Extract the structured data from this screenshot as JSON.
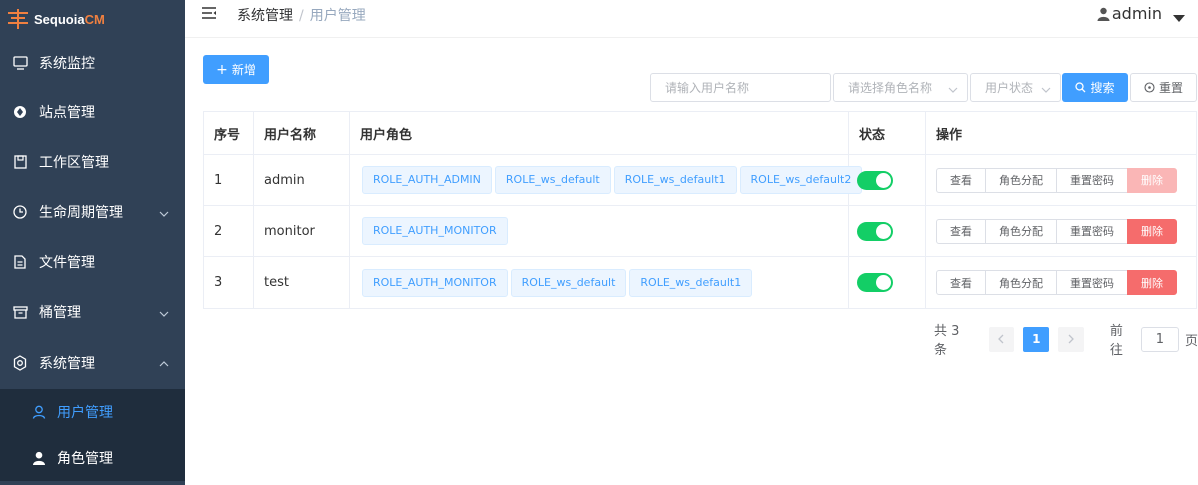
{
  "app": {
    "logo_main": "Sequoia",
    "logo_accent": "CM",
    "accent_color": "#409eff",
    "sidebar_bg": "#304156"
  },
  "sidebar": {
    "items": [
      {
        "label": "系统监控",
        "icon": "monitor-icon"
      },
      {
        "label": "站点管理",
        "icon": "site-icon"
      },
      {
        "label": "工作区管理",
        "icon": "workspace-icon"
      },
      {
        "label": "生命周期管理",
        "icon": "clock-icon",
        "expandable": true
      },
      {
        "label": "文件管理",
        "icon": "file-icon"
      },
      {
        "label": "桶管理",
        "icon": "bucket-icon",
        "expandable": true
      },
      {
        "label": "系统管理",
        "icon": "gear-icon",
        "expanded": true
      }
    ],
    "subitems": [
      {
        "label": "用户管理",
        "icon": "user-icon",
        "active": true
      },
      {
        "label": "角色管理",
        "icon": "user-filled-icon"
      }
    ]
  },
  "header": {
    "breadcrumb": [
      "系统管理",
      "用户管理"
    ],
    "username": "admin"
  },
  "toolbar": {
    "add_label": "新增",
    "username_placeholder": "请输入用户名称",
    "role_placeholder": "请选择角色名称",
    "status_placeholder": "用户状态",
    "search_label": "搜索",
    "reset_label": "重置"
  },
  "table": {
    "headers": [
      "序号",
      "用户名称",
      "用户角色",
      "状态",
      "操作"
    ],
    "rows": [
      {
        "index": "1",
        "name": "admin",
        "roles": [
          "ROLE_AUTH_ADMIN",
          "ROLE_ws_default",
          "ROLE_ws_default1",
          "ROLE_ws_default2"
        ],
        "enabled": true,
        "delete_disabled": true
      },
      {
        "index": "2",
        "name": "monitor",
        "roles": [
          "ROLE_AUTH_MONITOR"
        ],
        "enabled": true,
        "delete_disabled": false
      },
      {
        "index": "3",
        "name": "test",
        "roles": [
          "ROLE_AUTH_MONITOR",
          "ROLE_ws_default",
          "ROLE_ws_default1"
        ],
        "enabled": true,
        "delete_disabled": false
      }
    ],
    "actions": {
      "view": "查看",
      "assign_role": "角色分配",
      "reset_password": "重置密码",
      "delete": "删除"
    }
  },
  "pagination": {
    "total_text": "共 3 条",
    "current_page": "1",
    "goto_label": "前往",
    "goto_value": "1",
    "page_suffix": "页"
  }
}
